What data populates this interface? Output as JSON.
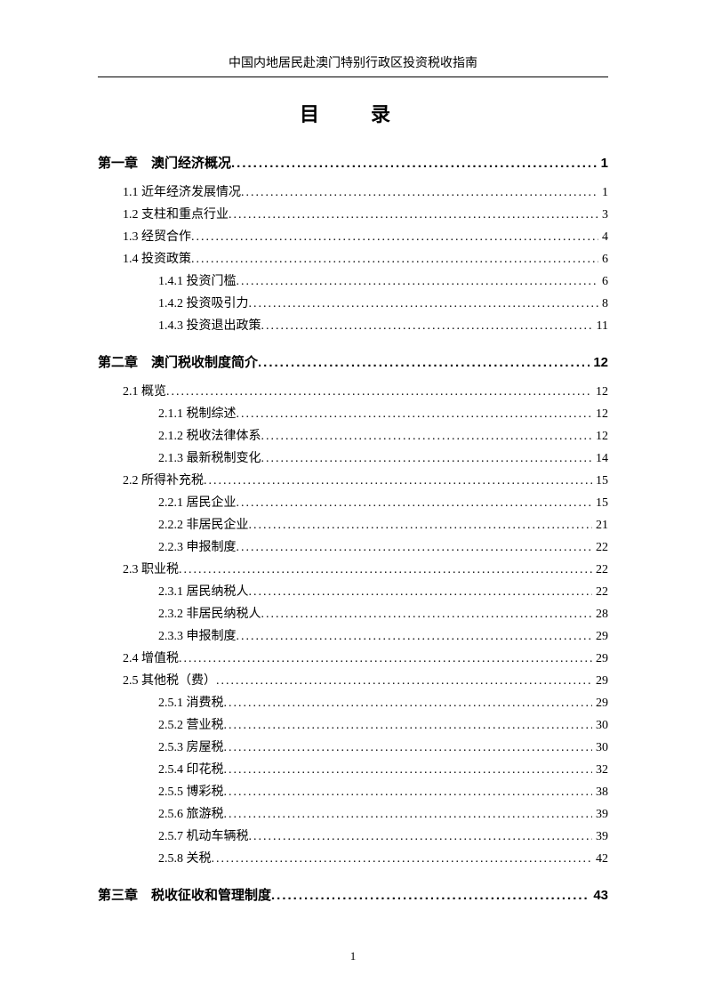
{
  "header": "中国内地居民赴澳门特别行政区投资税收指南",
  "title": "目　录",
  "pageNumber": "1",
  "entries": [
    {
      "level": "chapter",
      "label": "第一章　澳门经济概况",
      "page": "1"
    },
    {
      "level": "level1",
      "label": "1.1 近年经济发展情况",
      "page": "1"
    },
    {
      "level": "level1",
      "label": "1.2 支柱和重点行业",
      "page": "3"
    },
    {
      "level": "level1",
      "label": "1.3 经贸合作",
      "page": "4"
    },
    {
      "level": "level1",
      "label": "1.4 投资政策",
      "page": "6"
    },
    {
      "level": "level2",
      "label": "1.4.1 投资门槛",
      "page": "6"
    },
    {
      "level": "level2",
      "label": "1.4.2 投资吸引力",
      "page": "8"
    },
    {
      "level": "level2",
      "label": "1.4.3 投资退出政策",
      "page": "11"
    },
    {
      "level": "chapter",
      "label": "第二章　澳门税收制度简介",
      "page": "12"
    },
    {
      "level": "level1",
      "label": "2.1 概览",
      "page": "12"
    },
    {
      "level": "level2",
      "label": "2.1.1 税制综述",
      "page": "12"
    },
    {
      "level": "level2",
      "label": "2.1.2 税收法律体系",
      "page": "12"
    },
    {
      "level": "level2",
      "label": "2.1.3 最新税制变化",
      "page": "14"
    },
    {
      "level": "level1",
      "label": "2.2 所得补充税",
      "page": "15"
    },
    {
      "level": "level2",
      "label": "2.2.1 居民企业",
      "page": "15"
    },
    {
      "level": "level2",
      "label": "2.2.2 非居民企业",
      "page": "21"
    },
    {
      "level": "level2",
      "label": "2.2.3 申报制度",
      "page": "22"
    },
    {
      "level": "level1",
      "label": "2.3 职业税",
      "page": "22"
    },
    {
      "level": "level2",
      "label": "2.3.1 居民纳税人",
      "page": "22"
    },
    {
      "level": "level2",
      "label": "2.3.2 非居民纳税人",
      "page": "28"
    },
    {
      "level": "level2",
      "label": "2.3.3 申报制度",
      "page": "29"
    },
    {
      "level": "level1",
      "label": "2.4 增值税",
      "page": "29"
    },
    {
      "level": "level1",
      "label": "2.5 其他税（费）",
      "page": "29"
    },
    {
      "level": "level2",
      "label": "2.5.1 消费税",
      "page": "29"
    },
    {
      "level": "level2",
      "label": "2.5.2 营业税",
      "page": "30"
    },
    {
      "level": "level2",
      "label": "2.5.3 房屋税",
      "page": "30"
    },
    {
      "level": "level2",
      "label": "2.5.4 印花税",
      "page": "32"
    },
    {
      "level": "level2",
      "label": "2.5.5 博彩税",
      "page": "38"
    },
    {
      "level": "level2",
      "label": "2.5.6 旅游税",
      "page": "39"
    },
    {
      "level": "level2",
      "label": "2.5.7 机动车辆税",
      "page": "39"
    },
    {
      "level": "level2",
      "label": "2.5.8 关税",
      "page": "42"
    },
    {
      "level": "chapter",
      "label": "第三章　税收征收和管理制度",
      "page": "43"
    }
  ]
}
